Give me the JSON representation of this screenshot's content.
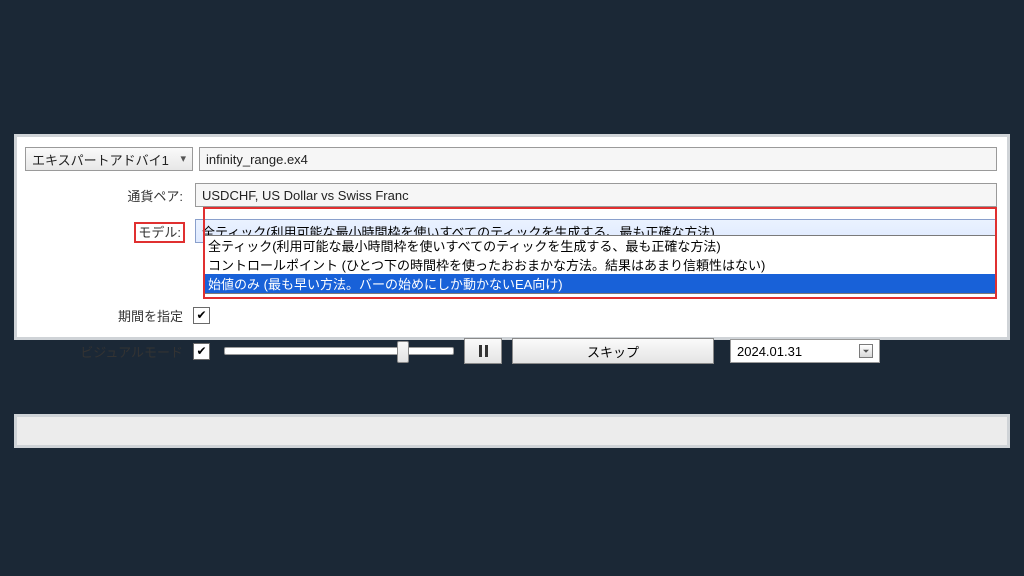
{
  "ea_selector": {
    "label": "エキスパートアドバイ1"
  },
  "ea_file": "infinity_range.ex4",
  "pair": {
    "label": "通貨ペア:",
    "value": "USDCHF, US Dollar vs Swiss Franc"
  },
  "model": {
    "label": "モデル:",
    "selected": "全ティック(利用可能な最小時間枠を使いすべてのティックを生成する、最も正確な方法)",
    "options": [
      "全ティック(利用可能な最小時間枠を使いすべてのティックを生成する、最も正確な方法)",
      "コントロールポイント (ひとつ下の時間枠を使ったおおまかな方法。結果はあまり信頼性はない)",
      "始値のみ (最も早い方法。バーの始めにしか動かないEA向け)"
    ],
    "highlighted_index": 2
  },
  "period": {
    "label": "期間を指定",
    "checked": true
  },
  "visual": {
    "label": "ビジュアルモード",
    "checked": true,
    "skip_label": "スキップ",
    "date": "2024.01.31"
  }
}
